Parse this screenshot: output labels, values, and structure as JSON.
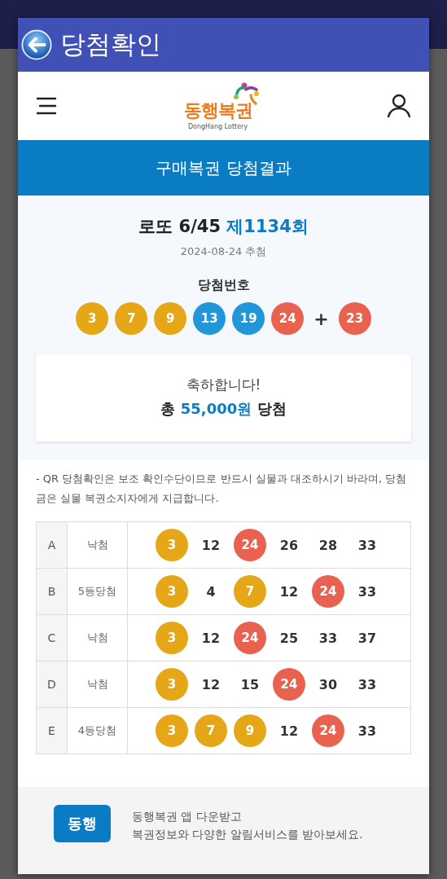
{
  "dialog": {
    "title": "당첨확인"
  },
  "header": {
    "logo_text": "동행복권",
    "logo_subtext": "DongHang Lottery"
  },
  "banner": "구매복권 당첨결과",
  "result": {
    "game": "로또 6/45",
    "round": "제1134회",
    "date": "2024-08-24 추첨",
    "numbers_label": "당첨번호",
    "numbers": [
      {
        "value": "3",
        "color": "#e5a718"
      },
      {
        "value": "7",
        "color": "#e5a718"
      },
      {
        "value": "9",
        "color": "#e5a718"
      },
      {
        "value": "13",
        "color": "#2196d8"
      },
      {
        "value": "19",
        "color": "#2196d8"
      },
      {
        "value": "24",
        "color": "#e8624f"
      }
    ],
    "bonus_sign": "+",
    "bonus": {
      "value": "23",
      "color": "#e8624f"
    },
    "message": "축하합니다!",
    "prize_prefix": "총",
    "prize_amount": "55,000원",
    "prize_suffix": "당첨"
  },
  "notice": "- QR 당첨확인은 보조 확인수단이므로 반드시 실물과 대조하시기 바라며, 당첨금은 실물 복권소지자에게 지급합니다.",
  "tickets": [
    {
      "slot": "A",
      "status": "낙첨",
      "numbers": [
        {
          "value": "3",
          "matched": true,
          "color": "#e5a718"
        },
        {
          "value": "12",
          "matched": false
        },
        {
          "value": "24",
          "matched": true,
          "color": "#e8624f"
        },
        {
          "value": "26",
          "matched": false
        },
        {
          "value": "28",
          "matched": false
        },
        {
          "value": "33",
          "matched": false
        }
      ]
    },
    {
      "slot": "B",
      "status": "5등당첨",
      "numbers": [
        {
          "value": "3",
          "matched": true,
          "color": "#e5a718"
        },
        {
          "value": "4",
          "matched": false
        },
        {
          "value": "7",
          "matched": true,
          "color": "#e5a718"
        },
        {
          "value": "12",
          "matched": false
        },
        {
          "value": "24",
          "matched": true,
          "color": "#e8624f"
        },
        {
          "value": "33",
          "matched": false
        }
      ]
    },
    {
      "slot": "C",
      "status": "낙첨",
      "numbers": [
        {
          "value": "3",
          "matched": true,
          "color": "#e5a718"
        },
        {
          "value": "12",
          "matched": false
        },
        {
          "value": "24",
          "matched": true,
          "color": "#e8624f"
        },
        {
          "value": "25",
          "matched": false
        },
        {
          "value": "33",
          "matched": false
        },
        {
          "value": "37",
          "matched": false
        }
      ]
    },
    {
      "slot": "D",
      "status": "낙첨",
      "numbers": [
        {
          "value": "3",
          "matched": true,
          "color": "#e5a718"
        },
        {
          "value": "12",
          "matched": false
        },
        {
          "value": "15",
          "matched": false
        },
        {
          "value": "24",
          "matched": true,
          "color": "#e8624f"
        },
        {
          "value": "30",
          "matched": false
        },
        {
          "value": "33",
          "matched": false
        }
      ]
    },
    {
      "slot": "E",
      "status": "4등당첨",
      "numbers": [
        {
          "value": "3",
          "matched": true,
          "color": "#e5a718"
        },
        {
          "value": "7",
          "matched": true,
          "color": "#e5a718"
        },
        {
          "value": "9",
          "matched": true,
          "color": "#e5a718"
        },
        {
          "value": "12",
          "matched": false
        },
        {
          "value": "24",
          "matched": true,
          "color": "#e8624f"
        },
        {
          "value": "33",
          "matched": false
        }
      ]
    }
  ],
  "app_promo": {
    "icon_text": "동행",
    "line_1": "동행복권 앱 다운받고",
    "line_2": "복권정보와 다양한 알림서비스를 받아보세요."
  }
}
